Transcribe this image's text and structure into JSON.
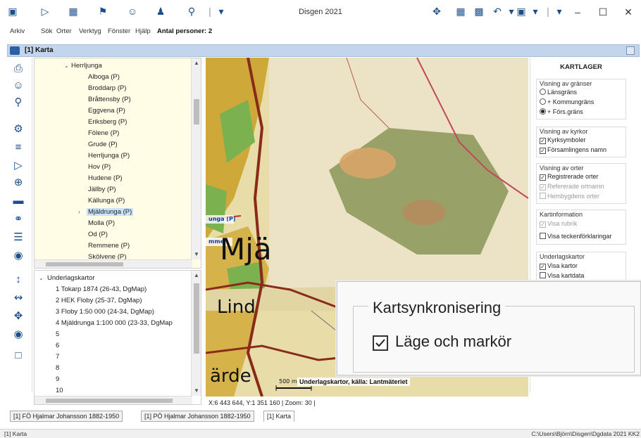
{
  "window": {
    "title": "Disgen 2021",
    "quick_access_icons": [
      "app-icon",
      "filter-icon",
      "calendar-icon",
      "flag-icon",
      "person-icon",
      "person-pin-icon",
      "map-pin-icon"
    ]
  },
  "menu": {
    "items": [
      "Arkiv",
      "Sök",
      "Orter",
      "Verktyg",
      "Fönster",
      "Hjälp"
    ],
    "persons_label": "Antal personer: 2"
  },
  "document": {
    "title": "[1] Karta"
  },
  "tree_top": {
    "root": "Herrljunga",
    "items": [
      "Alboga (P)",
      "Broddarp (P)",
      "Bråttensby (P)",
      "Eggvena (P)",
      "Eriksberg (P)",
      "Fölene (P)",
      "Grude (P)",
      "Herrljunga (P)",
      "Hov (P)",
      "Hudene (P)",
      "Jällby (P)",
      "Källunga (P)",
      "Mjäldrunga (P)",
      "Molla (P)",
      "Od (P)",
      "Remmene (P)",
      "Skölvene (P)"
    ],
    "selected_index": 12
  },
  "tree_bottom": {
    "root": "Underlagskartor",
    "items": [
      "1 Tokarp 1874 (26-43, DgMap)",
      "2 HEK Floby  (25-37, DgMap)",
      "3 Floby 1:50 000 (24-34, DgMap)",
      "4 Mjäldrunga 1:100 000 (23-33, DgMap",
      "5",
      "6",
      "7",
      "8",
      "9",
      "10"
    ]
  },
  "map": {
    "labels": {
      "mja": "Mjä",
      "linda": "Lind",
      "varde": "ärde",
      "unga": "unga (P)",
      "mme": "mme"
    },
    "scale": "500 m",
    "underlay_note": "Underlagskartor, källa: Lantmäteriet",
    "coords": "X:6 443 644, Y:1 351 160  |  Zoom: 30  |"
  },
  "layers": {
    "title": "KARTLAGER",
    "boundaries": {
      "title": "Visning av gränser",
      "options": [
        "Länsgräns",
        "+ Kommungräns",
        "+ Förs.gräns"
      ],
      "selected": 2
    },
    "churches": {
      "title": "Visning av kyrkor",
      "options": [
        "Kyrksymboler",
        "Församlingens namn"
      ]
    },
    "places": {
      "title": "Visning av orter",
      "options": [
        "Registrerade orter",
        "Refererade ortnamn",
        "Hembygdens orter"
      ]
    },
    "mapinfo": {
      "title": "Kartinformation",
      "options": [
        "Visa rubrik",
        "Visa teckenförklaringar"
      ]
    },
    "underlay": {
      "title": "Underlagskartor",
      "options": [
        "Visa kartor",
        "Visa kartdata"
      ]
    }
  },
  "callout": {
    "title": "Kartsynkronisering",
    "label": "Läge och markör"
  },
  "tabs": [
    "[1] FÖ Hjalmar Johansson 1882-1950",
    "[1] PÖ Hjalmar Johansson 1882-1950",
    "[1] Karta"
  ],
  "status": {
    "left": "[1] Karta",
    "right": "C:\\Users\\Björn\\Disgen\\Dgdata 2021 KK2"
  }
}
